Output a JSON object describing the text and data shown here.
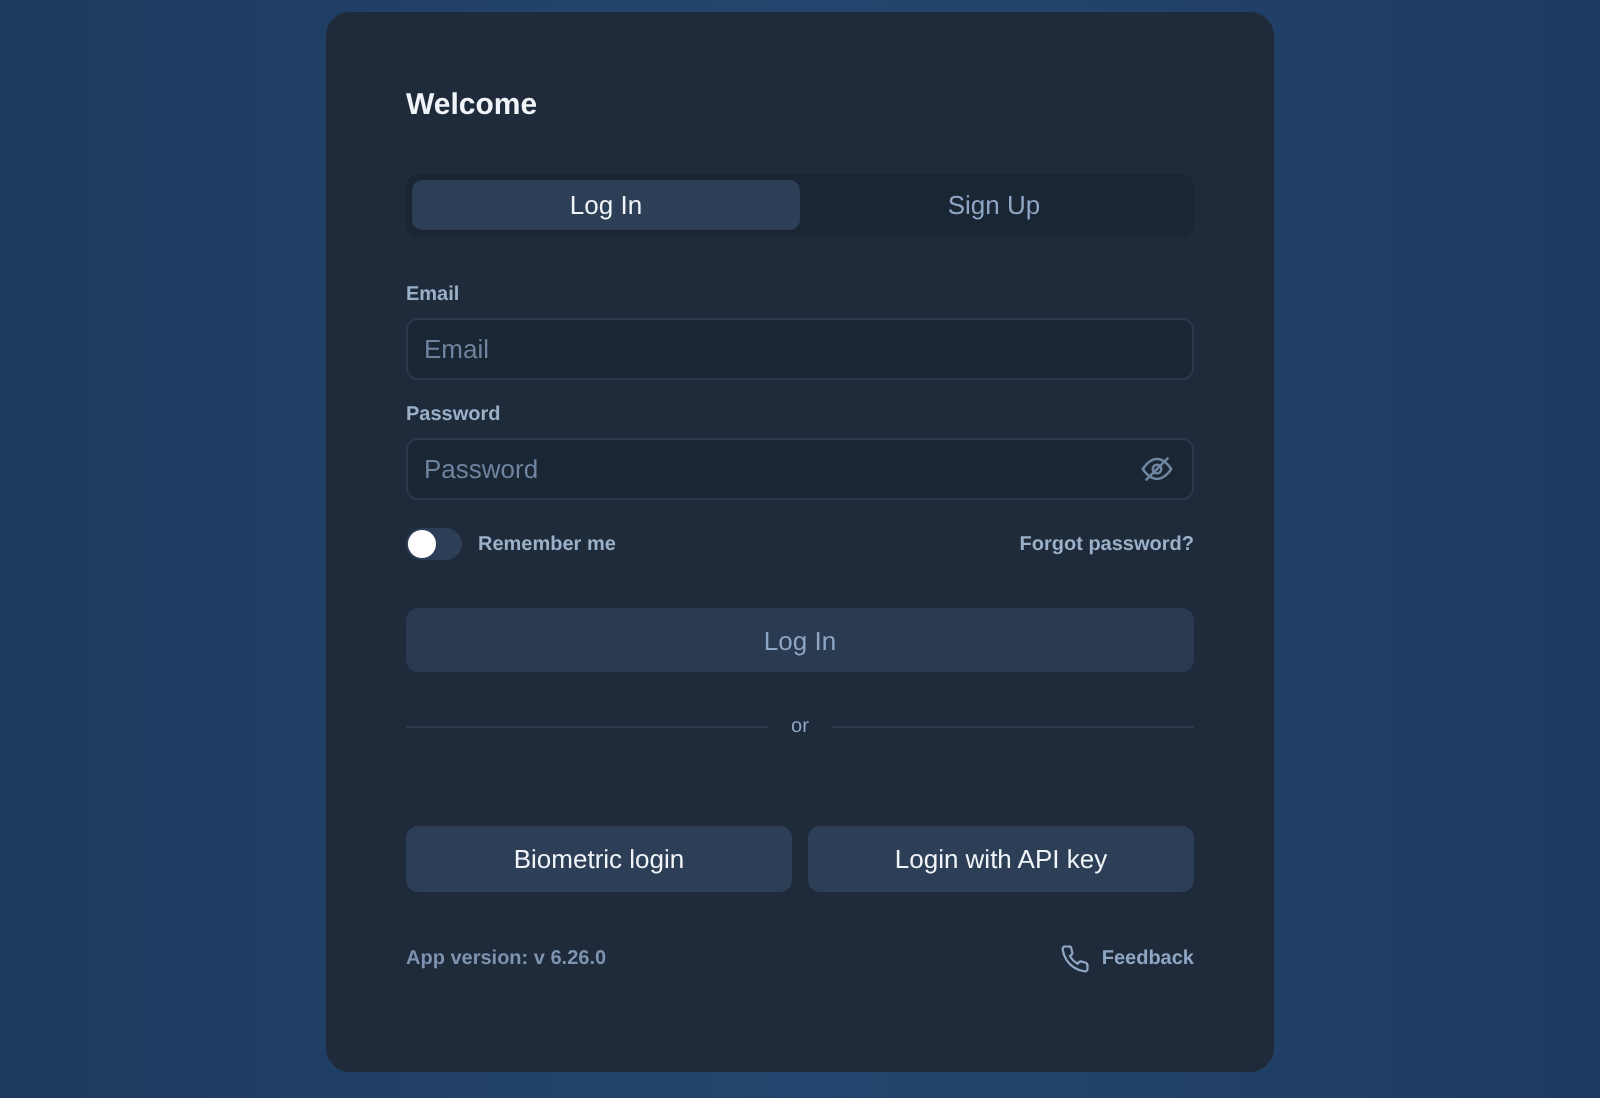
{
  "card": {
    "title": "Welcome"
  },
  "tabs": [
    {
      "label": "Log In",
      "selected": true
    },
    {
      "label": "Sign Up",
      "selected": false
    }
  ],
  "fields": [
    {
      "label": "Email",
      "placeholder": "Email",
      "kind": "text"
    },
    {
      "label": "Password",
      "placeholder": "Password",
      "kind": "password"
    }
  ],
  "remember": {
    "label": "Remember me",
    "on": false
  },
  "forgot_link": "Forgot password?",
  "submit": {
    "label": "Log In",
    "disabled": true
  },
  "divider": "or",
  "alt_buttons": [
    "Biometric login",
    "Login with API key"
  ],
  "footer": {
    "version": "App version: v 6.26.0",
    "feedback": "Feedback"
  }
}
